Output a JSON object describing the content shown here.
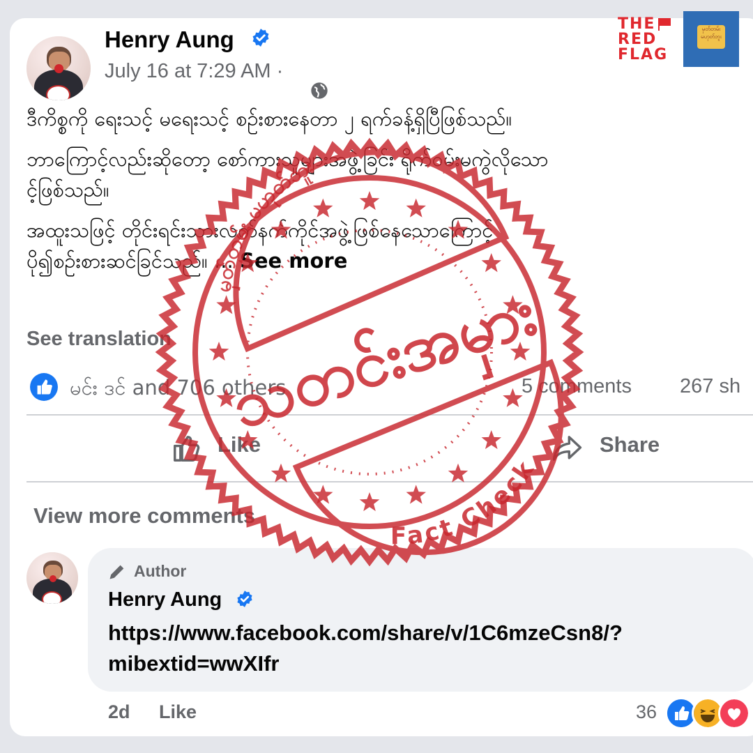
{
  "post": {
    "author": "Henry Aung",
    "timestamp": "July 16 at 7:29 AM ·",
    "paragraphs": [
      "ဒီကိစ္စကို ရေးသင့် မရေးသင့် စဉ်းစားနေတာ ၂ ရက်ခန့်ရှိပြီဖြစ်သည်။",
      "ဘာကြောင့်လည်းဆိုတော့ စော်ကားသူများအဖွဲ့ခြင်း ရိုက်ဝမ်းမကွဲလိုသော",
      "င့်ဖြစ်သည်။",
      "အထူးသဖြင့် တိုင်းရင်းသားလက်နက်ကိုင်အဖွဲ့ဖြစ်နေသောကြောင့်",
      "ပို၍စဉ်းစားဆင်ခြင်သည်။ ... "
    ],
    "see_more": "See more",
    "see_translation": "See translation",
    "reactions_text": "မင်း ဒင် and 706 others",
    "comments_count": "5 comments",
    "shares_count": "267 sh",
    "like_label": "Like",
    "share_label": "Share"
  },
  "comments": {
    "view_more": "View more comments",
    "author_tag": "Author",
    "name": "Henry Aung",
    "link_line1": "https://www.facebook.com/share/v/1C6mzeCsn8/?",
    "link_line2": "mibextid=wwXIfr",
    "age": "2d",
    "like": "Like",
    "reaction_count": "36"
  },
  "branding": {
    "red_flag_lines": [
      "THE",
      "RED",
      "FLAG"
    ],
    "blue_logo_text": "မှတ်တမ်း မဟုတ်ဘူး"
  },
  "stamp": {
    "verdict": "သတင်းအမှား",
    "top_arc_text": "မှတ်တမ်း မဟုတ်ဘူး",
    "bottom_arc_text": "Fact Check",
    "color": "#c8262d"
  }
}
